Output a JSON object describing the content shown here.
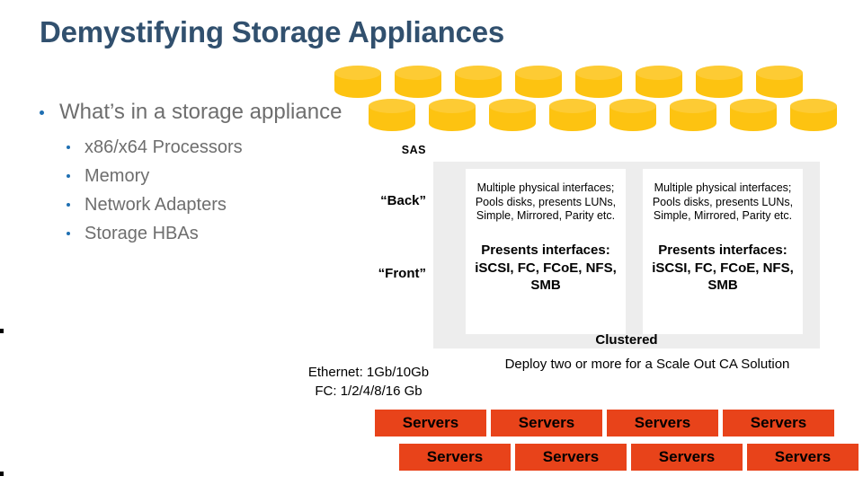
{
  "slide": {
    "title": "Demystifying Storage Appliances"
  },
  "bullets": {
    "main": "What’s in a storage appliance",
    "sub": [
      "x86/x64 Processors",
      "Memory",
      "Network Adapters",
      "Storage HBAs"
    ]
  },
  "diagram": {
    "labels": {
      "sas": "SAS",
      "back": "“Back”",
      "front": "“Front”"
    },
    "clustered_label": "Clustered",
    "nodes": [
      {
        "description": "Multiple physical interfaces; Pools disks, presents LUNs, Simple, Mirrored, Parity etc.",
        "presents_heading": "Presents interfaces:",
        "interfaces": "iSCSI, FC, FCoE, NFS, SMB"
      },
      {
        "description": "Multiple physical interfaces; Pools disks, presents LUNs, Simple, Mirrored, Parity etc.",
        "presents_heading": "Presents interfaces:",
        "interfaces": "iSCSI, FC, FCoE, NFS, SMB"
      }
    ],
    "disk_count_top": 8,
    "disk_count_bottom": 8
  },
  "annotations": {
    "speeds_line1": "Ethernet: 1Gb/10Gb",
    "speeds_line2": "FC: 1/2/4/8/16 Gb",
    "deploy_note": "Deploy two or more for a Scale Out CA Solution"
  },
  "servers": {
    "label": "Servers",
    "row1_count": 4,
    "row2_count": 4
  },
  "colors": {
    "title": "#31506E",
    "bullet_text": "#6E6E6E",
    "bullet_dot": "#1F6FB2",
    "disk_body": "#FDC311",
    "disk_top": "#FDCB34",
    "panel_grey": "#EDEDED",
    "server_orange": "#E8431A"
  }
}
